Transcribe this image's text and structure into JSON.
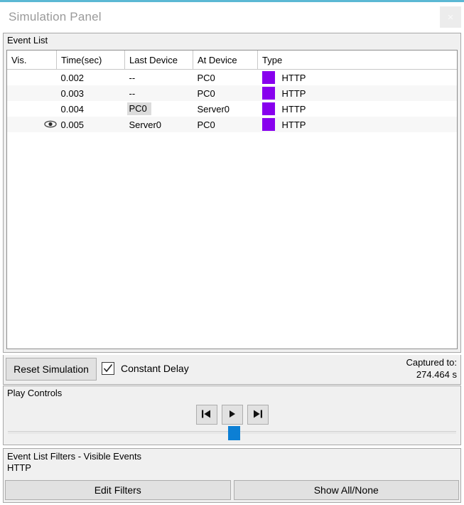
{
  "window": {
    "title": "Simulation Panel",
    "close_label": "×",
    "accent_color": "#5bb8d4"
  },
  "event_list": {
    "group_label": "Event List",
    "columns": [
      "Vis.",
      "Time(sec)",
      "Last Device",
      "At Device",
      "Type"
    ],
    "type_color": "#8800ee",
    "rows": [
      {
        "vis": "",
        "time": "0.002",
        "last_device": "--",
        "at_device": "PC0",
        "type": "HTTP",
        "selected_cell": false
      },
      {
        "vis": "",
        "time": "0.003",
        "last_device": "--",
        "at_device": "PC0",
        "type": "HTTP",
        "selected_cell": false
      },
      {
        "vis": "",
        "time": "0.004",
        "last_device": "PC0",
        "at_device": "Server0",
        "type": "HTTP",
        "selected_cell": true
      },
      {
        "vis": "eye-icon",
        "time": "0.005",
        "last_device": "Server0",
        "at_device": "PC0",
        "type": "HTTP",
        "selected_cell": false
      }
    ]
  },
  "controls": {
    "reset_label": "Reset Simulation",
    "constant_delay_label": "Constant Delay",
    "constant_delay_checked": true,
    "captured_label": "Captured to:",
    "captured_value": "274.464 s"
  },
  "play_controls": {
    "group_label": "Play Controls",
    "back_icon": "skip-to-start-icon",
    "play_icon": "play-icon",
    "forward_icon": "skip-to-end-icon",
    "slider_handle_color": "#0c7fd4"
  },
  "filters": {
    "title": "Event List Filters - Visible Events",
    "visible_events": "HTTP",
    "edit_label": "Edit Filters",
    "show_all_label": "Show All/None"
  }
}
